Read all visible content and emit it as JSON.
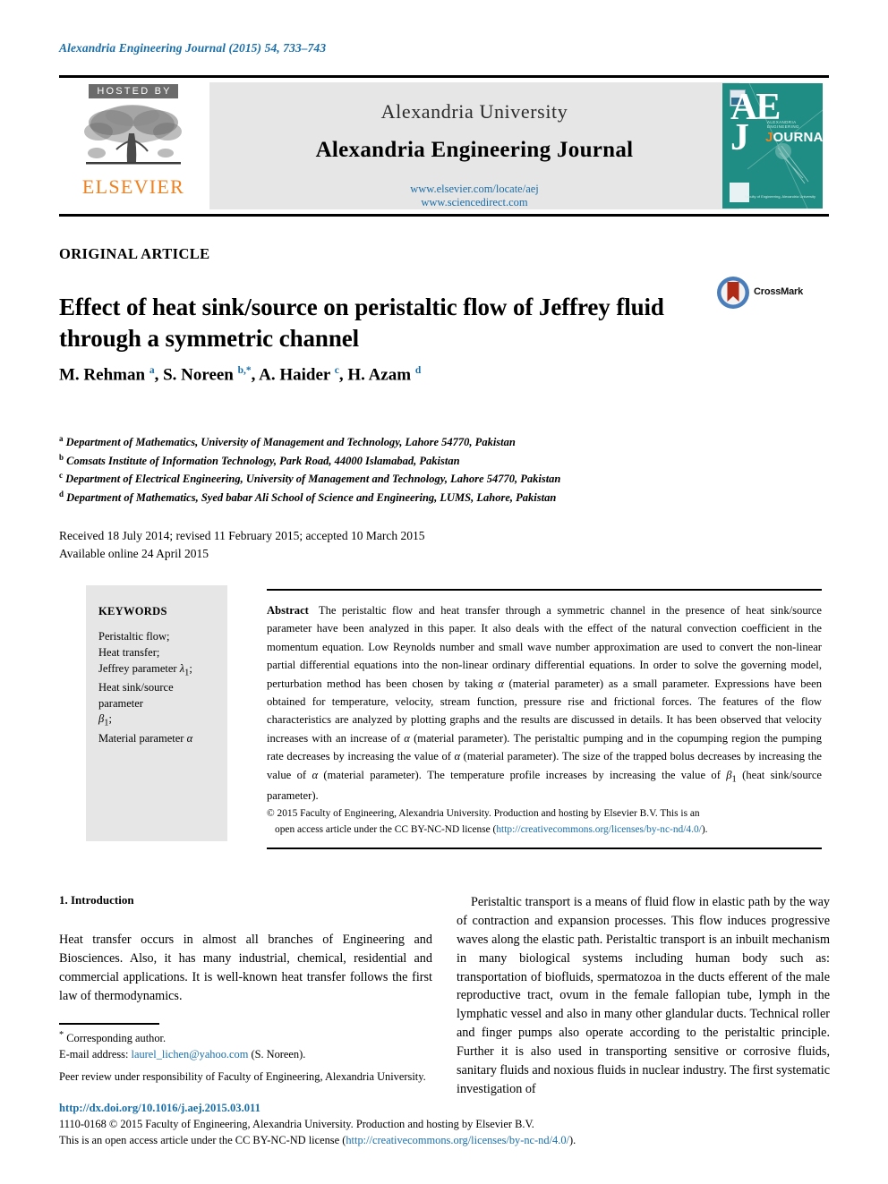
{
  "running_head": "Alexandria Engineering Journal (2015) 54, 733–743",
  "masthead": {
    "hosted_by": "HOSTED BY",
    "publisher": "ELSEVIER",
    "university": "Alexandria University",
    "journal": "Alexandria Engineering Journal",
    "url_locate": "www.elsevier.com/locate/aej",
    "url_sciencedirect": "www.sciencedirect.com",
    "cover": {
      "letter_a": "A",
      "letter_e": "E",
      "letter_j": "J",
      "journal_word_j": "J",
      "journal_word_rest": "OURNAL",
      "cover_subtitle": "ALEXANDRIA ENGINEERING",
      "cover_footer": "Faculty of Engineering, Alexandria University"
    }
  },
  "article": {
    "type": "ORIGINAL ARTICLE",
    "title": "Effect of heat sink/source on peristaltic flow of Jeffrey fluid through a symmetric channel",
    "crossmark_label": "CrossMark",
    "authors_html": "M. Rehman <sup>a</sup>, S. Noreen <sup>b,</sup><sup>*</sup>, A. Haider <sup>c</sup>, H. Azam <sup>d</sup>",
    "affiliations": [
      {
        "mark": "a",
        "text": "Department of Mathematics, University of Management and Technology, Lahore 54770, Pakistan"
      },
      {
        "mark": "b",
        "text": "Comsats Institute of Information Technology, Park Road, 44000 Islamabad, Pakistan"
      },
      {
        "mark": "c",
        "text": "Department of Electrical Engineering, University of Management and Technology, Lahore 54770, Pakistan"
      },
      {
        "mark": "d",
        "text": "Department of Mathematics, Syed babar Ali School of Science and Engineering, LUMS, Lahore, Pakistan"
      }
    ],
    "received_line": "Received 18 July 2014; revised 11 February 2015; accepted 10 March 2015",
    "available_line": "Available online 24 April 2015"
  },
  "keywords": {
    "title": "KEYWORDS",
    "items_html": "Peristaltic flow;<br>Heat transfer;<br>Jeffrey parameter <i>&lambda;</i><sub>1</sub>;<br>Heat sink/source parameter<br><i>&beta;</i><sub>1</sub>;<br>Material parameter <i>&alpha;</i>"
  },
  "abstract": {
    "label": "Abstract",
    "text_html": "The peristaltic flow and heat transfer through a symmetric channel in the presence of heat sink/source parameter have been analyzed in this paper. It also deals with the effect of the natural convection coefficient in the momentum equation. Low Reynolds number and small wave number approximation are used to convert the non-linear partial differential equations into the non-linear ordinary differential equations. In order to solve the governing model, perturbation method has been chosen by taking <i>&alpha;</i> (material parameter) as a small parameter. Expressions have been obtained for temperature, velocity, stream function, pressure rise and frictional forces. The features of the flow characteristics are analyzed by plotting graphs and the results are discussed in details. It has been observed that velocity increases with an increase of <i>&alpha;</i> (material parameter). The peristaltic pumping and in the copumping region the pumping rate decreases by increasing the value of <i>&alpha;</i> (material parameter). The size of the trapped bolus decreases by increasing the value of <i>&alpha;</i> (material parameter). The temperature profile increases by increasing the value of <i>&beta;</i><sub>1</sub> (heat sink/source parameter).",
    "copyright_line1": "© 2015 Faculty of Engineering, Alexandria University. Production and hosting by Elsevier B.V. This is an",
    "copyright_line2_pre": "open access article under the CC BY-NC-ND license (",
    "copyright_license_url": "http://creativecommons.org/licenses/by-nc-nd/4.0/",
    "copyright_line2_post": ")."
  },
  "body": {
    "section_heading": "1. Introduction",
    "left_paragraph": "Heat transfer occurs in almost all branches of Engineering and Biosciences. Also, it has many industrial, chemical, residential and commercial applications. It is well-known heat transfer follows the first law of thermodynamics.",
    "right_paragraph": "Peristaltic transport is a means of fluid flow in elastic path by the way of contraction and expansion processes. This flow induces progressive waves along the elastic path. Peristaltic transport is an inbuilt mechanism in many biological systems including human body such as: transportation of biofluids, spermatozoa in the ducts efferent of the male reproductive tract, ovum in the female fallopian tube, lymph in the lymphatic vessel and also in many other glandular ducts. Technical roller and finger pumps also operate according to the peristaltic principle. Further it is also used in transporting sensitive or corrosive fluids, sanitary fluids and noxious fluids in nuclear industry. The first systematic investigation of"
  },
  "footnotes": {
    "corresponding": "Corresponding author.",
    "email_label": "E-mail address:",
    "email": "laurel_lichen@yahoo.com",
    "email_suffix": "(S. Noreen).",
    "peer_review": "Peer review under responsibility of Faculty of Engineering, Alexandria University.",
    "doi": "http://dx.doi.org/10.1016/j.aej.2015.03.011",
    "issn_line": "1110-0168 © 2015 Faculty of Engineering, Alexandria University. Production and hosting by Elsevier B.V.",
    "license_pre": "This is an open access article under the CC BY-NC-ND license (",
    "license_url": "http://creativecommons.org/licenses/by-nc-nd/4.0/",
    "license_post": ")."
  },
  "colors": {
    "link_blue": "#1a6ea8",
    "elsevier_orange": "#f08020",
    "panel_gray": "#e6e6e6",
    "cover_teal": "#1f8d83",
    "crossmark_red": "#b02b17",
    "crossmark_blue": "#4a7ebb"
  }
}
